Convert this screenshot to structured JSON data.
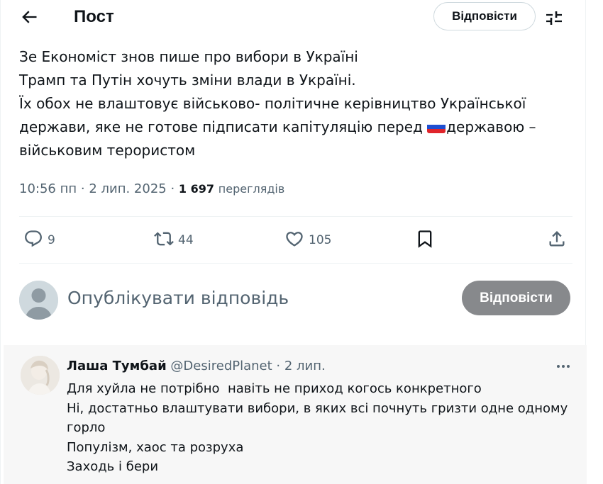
{
  "header": {
    "title": "Пост",
    "reply_button": "Відповісти"
  },
  "post": {
    "lines": [
      "Зе Економіст знов пише про вибори в Україні",
      "Трамп та Путін хочуть зміни влади в Україні.",
      "Їх обох не влаштовує військово- політичне керівництво Української",
      "держави, яке не готове підписати капітуляцію перед ",
      "державою –",
      "військовим терористом"
    ],
    "time": "10:56 пп",
    "date": "2 лип. 2025",
    "views_count": "1 697",
    "views_label": "переглядів"
  },
  "actions": {
    "replies": "9",
    "reposts": "44",
    "likes": "105"
  },
  "composer": {
    "placeholder": "Опублікувати відповідь",
    "button": "Відповісти"
  },
  "reply": {
    "name": "Лаша Тумбай",
    "handle": "@DesiredPlanet",
    "date": "2 лип.",
    "lines": [
      "Для хуйла не потрібно  навіть не приход когось конкретного",
      "Ні, достатньо влаштувати вибори, в яких всі почнуть гризти одне одному",
      "горло",
      "Популізм, хаос та розруха",
      "Заходь і бери"
    ]
  },
  "colors": {
    "text": "#0f1419",
    "secondary": "#536471",
    "reply_button_bg": "#87898c",
    "reply_section_bg": "#f7f7f7"
  },
  "icons": [
    "back-arrow-icon",
    "sliders-icon",
    "reply-icon",
    "repost-icon",
    "like-icon",
    "bookmark-icon",
    "share-icon",
    "more-icon",
    "russia-flag-icon"
  ]
}
